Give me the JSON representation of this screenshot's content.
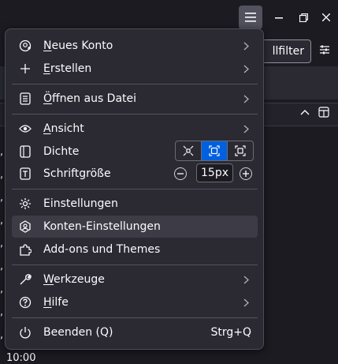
{
  "background": {
    "filter_button_label": "llfilter",
    "bottom_text": "10:00",
    "commas": [
      ",",
      ",",
      ",",
      ",",
      ",",
      ",",
      ",",
      ",",
      ","
    ]
  },
  "menu": {
    "new_account": {
      "pre": "",
      "u": "N",
      "post": "eues Konto"
    },
    "create": {
      "pre": "",
      "u": "E",
      "post": "rstellen"
    },
    "open_file": {
      "pre": "",
      "u": "Ö",
      "post": "ffnen aus Datei"
    },
    "view": {
      "pre": "",
      "u": "A",
      "post": "nsicht"
    },
    "density_label": "Dichte",
    "font_size_label": "Schriftgröße",
    "font_size_value": "15px",
    "settings": "Einstellungen",
    "account_settings": "Konten-Einstellungen",
    "addons": "Add-ons und Themes",
    "tools": {
      "pre": "",
      "u": "W",
      "post": "erkzeuge"
    },
    "help": {
      "pre": "",
      "u": "H",
      "post": "ilfe"
    },
    "quit": "Beenden (Q)",
    "quit_shortcut": "Strg+Q"
  },
  "colors": {
    "accent": "#0060df",
    "menu_bg": "#2b2a33",
    "hover": "#3d3c46"
  }
}
